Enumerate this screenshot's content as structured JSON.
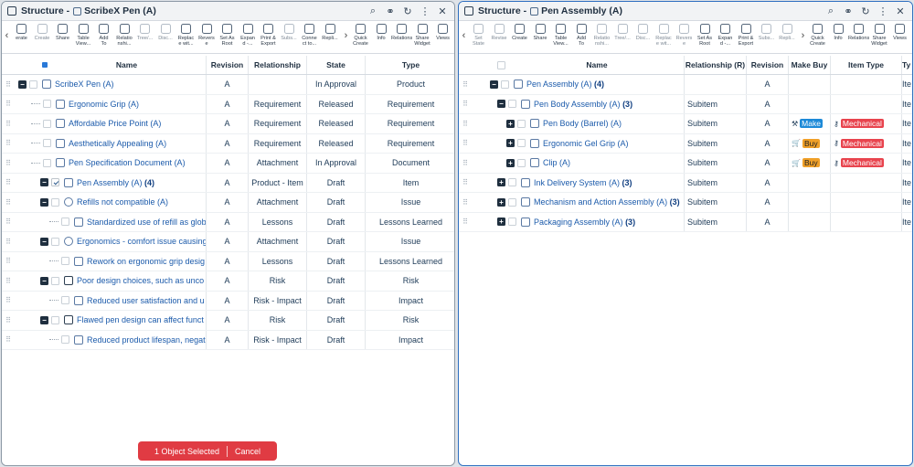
{
  "left": {
    "title": "Structure - ",
    "object": "ScribeX Pen (A)",
    "toolbar": [
      {
        "icon": "revise-icon",
        "label": "erate"
      },
      {
        "icon": "create-icon",
        "label": "Create"
      },
      {
        "icon": "share-icon",
        "label": "Share"
      },
      {
        "icon": "table-view-icon",
        "label": "Table\nView..."
      },
      {
        "icon": "add-to-icon",
        "label": "Add\nTo"
      },
      {
        "icon": "relationship-icon",
        "label": "Relatio\nnshi..."
      },
      {
        "icon": "tree-icon",
        "label": "Tree/..."
      },
      {
        "icon": "disconnect-icon",
        "label": "Disc..."
      },
      {
        "icon": "replace-icon",
        "label": "Replac\ne wit..."
      },
      {
        "icon": "reverse-icon",
        "label": "Revers\ne"
      },
      {
        "icon": "set-as-root-icon",
        "label": "Set As\nRoot"
      },
      {
        "icon": "expand-icon",
        "label": "Expan\nd -..."
      },
      {
        "icon": "print-export-icon",
        "label": "Print &\nExport"
      },
      {
        "icon": "subscribe-icon",
        "label": "Subs..."
      },
      {
        "icon": "connect-icon",
        "label": "Conne\nct to..."
      },
      {
        "icon": "replicate-icon",
        "label": "Repli..."
      },
      {
        "icon": "quick-create-icon",
        "label": "Quick\nCreate"
      },
      {
        "icon": "info-icon",
        "label": "Info"
      },
      {
        "icon": "relations-icon",
        "label": "Relations"
      },
      {
        "icon": "share-widget-icon",
        "label": "Share\nWidget"
      },
      {
        "icon": "views-icon",
        "label": "Views"
      }
    ],
    "headers": {
      "name": "Name",
      "revision": "Revision",
      "relationship": "Relationship",
      "state": "State",
      "type": "Type"
    },
    "rows": [
      {
        "name": "ScribeX Pen (A)",
        "revision": "A",
        "relationship": "",
        "state": "In Approval",
        "type": "Product"
      },
      {
        "name": "Ergonomic Grip (A)",
        "revision": "A",
        "relationship": "Requirement",
        "state": "Released",
        "type": "Requirement"
      },
      {
        "name": "Affordable Price Point (A)",
        "revision": "A",
        "relationship": "Requirement",
        "state": "Released",
        "type": "Requirement"
      },
      {
        "name": "Aesthetically Appealing (A)",
        "revision": "A",
        "relationship": "Requirement",
        "state": "Released",
        "type": "Requirement"
      },
      {
        "name": "Pen Specification Document (A)",
        "revision": "A",
        "relationship": "Attachment",
        "state": "In Approval",
        "type": "Document"
      },
      {
        "name": "Pen Assembly (A)",
        "count": "(4)",
        "revision": "A",
        "relationship": "Product - Item",
        "state": "Draft",
        "type": "Item"
      },
      {
        "name": "Refills not compatible (A)",
        "revision": "A",
        "relationship": "Attachment",
        "state": "Draft",
        "type": "Issue"
      },
      {
        "name": "Standardized use of refill as glob",
        "revision": "A",
        "relationship": "Lessons",
        "state": "Draft",
        "type": "Lessons Learned"
      },
      {
        "name": "Ergonomics - comfort issue causing",
        "revision": "A",
        "relationship": "Attachment",
        "state": "Draft",
        "type": "Issue"
      },
      {
        "name": "Rework on ergonomic grip desig",
        "revision": "A",
        "relationship": "Lessons",
        "state": "Draft",
        "type": "Lessons Learned"
      },
      {
        "name": "Poor design choices, such as unco",
        "revision": "A",
        "relationship": "Risk",
        "state": "Draft",
        "type": "Risk"
      },
      {
        "name": "Reduced user satisfaction and u",
        "revision": "A",
        "relationship": "Risk - Impact",
        "state": "Draft",
        "type": "Impact"
      },
      {
        "name": "Flawed pen design can affect funct",
        "revision": "A",
        "relationship": "Risk",
        "state": "Draft",
        "type": "Risk"
      },
      {
        "name": "Reduced product lifespan, negat",
        "revision": "A",
        "relationship": "Risk - Impact",
        "state": "Draft",
        "type": "Impact"
      }
    ],
    "selection": {
      "text": "1 Object Selected",
      "cancel": "Cancel"
    }
  },
  "right": {
    "title": "Structure - ",
    "object": "Pen Assembly (A)",
    "toolbar": [
      {
        "icon": "set-state-icon",
        "label": "Set\nState"
      },
      {
        "icon": "revise-icon",
        "label": "Revise"
      },
      {
        "icon": "create-icon",
        "label": "Create"
      },
      {
        "icon": "share-icon",
        "label": "Share"
      },
      {
        "icon": "table-view-icon",
        "label": "Table\nView..."
      },
      {
        "icon": "add-to-icon",
        "label": "Add\nTo"
      },
      {
        "icon": "relationship-icon",
        "label": "Relatio\nnshi..."
      },
      {
        "icon": "tree-icon",
        "label": "Tree/..."
      },
      {
        "icon": "disconnect-icon",
        "label": "Disc..."
      },
      {
        "icon": "replace-icon",
        "label": "Replac\ne wit..."
      },
      {
        "icon": "reverse-icon",
        "label": "Revers\ne"
      },
      {
        "icon": "set-as-root-icon",
        "label": "Set As\nRoot"
      },
      {
        "icon": "expand-icon",
        "label": "Expan\nd -..."
      },
      {
        "icon": "print-export-icon",
        "label": "Print &\nExport"
      },
      {
        "icon": "subscribe-icon",
        "label": "Subs..."
      },
      {
        "icon": "replicate-icon",
        "label": "Repli..."
      },
      {
        "icon": "quick-create-icon",
        "label": "Quick\nCreate"
      },
      {
        "icon": "info-icon",
        "label": "Info"
      },
      {
        "icon": "relations-icon",
        "label": "Relations"
      },
      {
        "icon": "share-widget-icon",
        "label": "Share\nWidget"
      },
      {
        "icon": "views-icon",
        "label": "Views"
      }
    ],
    "headers": {
      "name": "Name",
      "relationship": "Relationship (R)",
      "revision": "Revision",
      "makebuy": "Make Buy",
      "itemtype": "Item Type",
      "type": "Ty"
    },
    "rows": [
      {
        "name": "Pen Assembly (A)",
        "count": "(4)",
        "relationship": "",
        "revision": "A",
        "makebuy": "",
        "itemtype": "",
        "type": "Ite"
      },
      {
        "name": "Pen Body Assembly (A)",
        "count": "(3)",
        "relationship": "Subitem",
        "revision": "A",
        "makebuy": "",
        "itemtype": "",
        "type": "Ite"
      },
      {
        "name": "Pen Body (Barrel) (A)",
        "relationship": "Subitem",
        "revision": "A",
        "makebuy": "Make",
        "itemtype": "Mechanical",
        "type": "Ite"
      },
      {
        "name": "Ergonomic Gel Grip (A)",
        "relationship": "Subitem",
        "revision": "A",
        "makebuy": "Buy",
        "itemtype": "Mechanical",
        "type": "Ite"
      },
      {
        "name": "Clip (A)",
        "relationship": "Subitem",
        "revision": "A",
        "makebuy": "Buy",
        "itemtype": "Mechanical",
        "type": "Ite"
      },
      {
        "name": "Ink Delivery System (A)",
        "count": "(3)",
        "relationship": "Subitem",
        "revision": "A",
        "makebuy": "",
        "itemtype": "",
        "type": "Ite"
      },
      {
        "name": "Mechanism and Action Assembly (A)",
        "count": "(3)",
        "relationship": "Subitem",
        "revision": "A",
        "makebuy": "",
        "itemtype": "",
        "type": "Ite"
      },
      {
        "name": "Packaging Assembly (A)",
        "count": "(3)",
        "relationship": "Subitem",
        "revision": "A",
        "makebuy": "",
        "itemtype": "",
        "type": "Ite"
      }
    ]
  }
}
